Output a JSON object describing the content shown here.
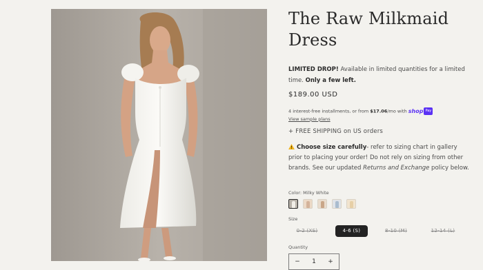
{
  "product": {
    "image_alt": "Model wearing the white milkmaid midi dress",
    "title_line1": "The Raw Milkmaid",
    "title_line2": "Dress",
    "limited_bold": "LIMITED DROP!",
    "limited_text": " Available in limited quantities for a limited time. ",
    "limited_emphasis": "Only a few left.",
    "price": "$189.00 USD",
    "installments_prefix": "4 interest-free installments, or from ",
    "installments_amount": "$17.06",
    "installments_suffix": "/mo with ",
    "shop_logo": "shop",
    "shop_pay_badge": "Pay",
    "sample_plans_link": "View sample plans",
    "shipping": "+ FREE SHIPPING on US orders",
    "sizing_icon": "warning-icon",
    "sizing_bold": "Choose size carefully",
    "sizing_text": "- refer to sizing chart in gallery prior to placing your order! Do not rely on sizing from other brands. See our updated ",
    "sizing_italic": "Returns and Exchange",
    "sizing_tail": " policy below.",
    "color_label": "Color: Milky White",
    "swatches": [
      {
        "name": "Milky White",
        "bg": "#b9b3aa",
        "fig": "#f2efe8",
        "selected": true
      },
      {
        "name": "swatch-2",
        "bg": "#ecd9c6",
        "fig": "#d4b39a",
        "selected": false
      },
      {
        "name": "swatch-3",
        "bg": "#e9dccd",
        "fig": "#c9a688",
        "selected": false
      },
      {
        "name": "swatch-4",
        "bg": "#dfe3e8",
        "fig": "#a9bccf",
        "selected": false
      },
      {
        "name": "swatch-5",
        "bg": "#f1e4cf",
        "fig": "#e6cfa6",
        "selected": false
      }
    ],
    "size_label": "Size",
    "sizes": [
      {
        "label": "0-2 (XS)",
        "available": false,
        "selected": false
      },
      {
        "label": "4-6 (S)",
        "available": true,
        "selected": true
      },
      {
        "label": "8-10 (M)",
        "available": false,
        "selected": false
      },
      {
        "label": "12-14 (L)",
        "available": false,
        "selected": false
      }
    ],
    "quantity_label": "Quantity",
    "quantity_minus": "−",
    "quantity_value": "1",
    "quantity_plus": "+"
  }
}
